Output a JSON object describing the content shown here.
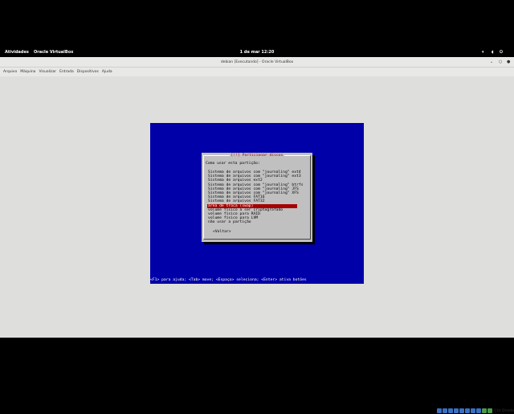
{
  "topbar": {
    "activities": "Atividades",
    "app": "Oracle VirtualBox",
    "clock": "1 de mar 12:20"
  },
  "window": {
    "title": "debian [Executando] - Oracle VirtualBox"
  },
  "menu": [
    "Arquivo",
    "Máquina",
    "Visualizar",
    "Entrada",
    "Dispositivos",
    "Ajuda"
  ],
  "dialog": {
    "title": "[!!] Particionar discos",
    "question": "Como usar esta partição:",
    "options": [
      "Sistema de arquivos com \"journaling\" ext4",
      "Sistema de arquivos com \"journaling\" ext3",
      "Sistema de arquivos ext2",
      "Sistema de arquivos com \"journaling\" btrfs",
      "Sistema de arquivos com \"journaling\" JFS",
      "Sistema de arquivos com \"journaling\" XFS",
      "Sistema de arquivos FAT16",
      "Sistema de arquivos FAT32",
      "área de troca (swap)",
      "volume físico a ser criptografado",
      "volume físico para RAID",
      "volume físico para LVM",
      "não usar a partição"
    ],
    "selected_index": 8,
    "back": "<Voltar>"
  },
  "status": "<F1> para ajuda; <Tab> move; <Espaço> seleciona; <Enter> ativa botões",
  "hostkey": "Ctrl Direito"
}
